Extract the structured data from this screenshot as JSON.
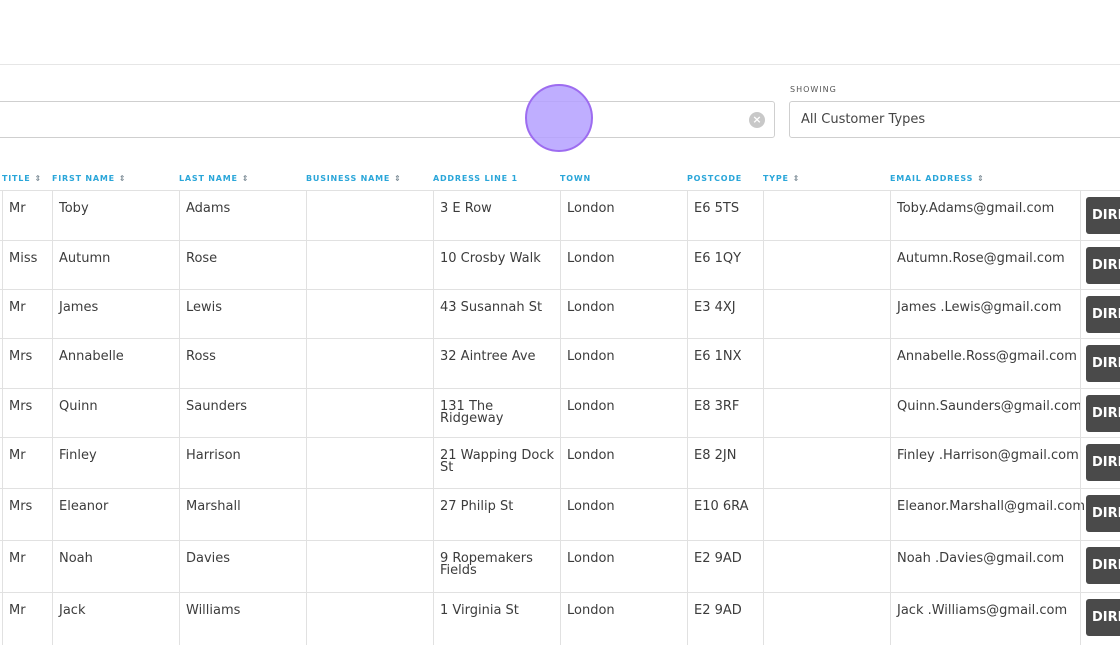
{
  "search": {
    "value": "",
    "clear_icon": "clear-circle-icon"
  },
  "filter": {
    "label": "SHOWING",
    "selected": "All Customer Types"
  },
  "table": {
    "columns": [
      {
        "label": "TITLE",
        "sortable": true
      },
      {
        "label": "FIRST NAME",
        "sortable": true
      },
      {
        "label": "LAST NAME",
        "sortable": true
      },
      {
        "label": "BUSINESS NAME",
        "sortable": true
      },
      {
        "label": "ADDRESS LINE 1",
        "sortable": false
      },
      {
        "label": "TOWN",
        "sortable": false
      },
      {
        "label": "POSTCODE",
        "sortable": false
      },
      {
        "label": "TYPE",
        "sortable": true
      },
      {
        "label": "EMAIL ADDRESS",
        "sortable": true
      }
    ],
    "sort_icon": "⌃⌄",
    "action_label": "DIRE",
    "rows": [
      {
        "title": "Mr",
        "first": "Toby",
        "last": "Adams",
        "business": "",
        "address": "3 E Row",
        "town": "London",
        "postcode": "E6 5TS",
        "type": "",
        "email": "Toby.Adams@gmail.com"
      },
      {
        "title": "Miss",
        "first": "Autumn",
        "last": "Rose",
        "business": "",
        "address": "10 Crosby Walk",
        "town": "London",
        "postcode": "E6 1QY",
        "type": "",
        "email": "Autumn.Rose@gmail.com"
      },
      {
        "title": "Mr",
        "first": "James",
        "last": "Lewis",
        "business": "",
        "address": "43 Susannah St",
        "town": "London",
        "postcode": "E3 4XJ",
        "type": "",
        "email": "James .Lewis@gmail.com"
      },
      {
        "title": "Mrs",
        "first": "Annabelle",
        "last": "Ross",
        "business": "",
        "address": "32 Aintree Ave",
        "town": "London",
        "postcode": "E6 1NX",
        "type": "",
        "email": "Annabelle.Ross@gmail.com"
      },
      {
        "title": "Mrs",
        "first": "Quinn",
        "last": "Saunders",
        "business": "",
        "address": "131 The Ridgeway",
        "town": "London",
        "postcode": "E8 3RF",
        "type": "",
        "email": "Quinn.Saunders@gmail.com"
      },
      {
        "title": "Mr",
        "first": "Finley",
        "last": "Harrison",
        "business": "",
        "address": "21 Wapping Dock St",
        "town": "London",
        "postcode": "E8 2JN",
        "type": "",
        "email": "Finley .Harrison@gmail.com"
      },
      {
        "title": "Mrs",
        "first": "Eleanor",
        "last": "Marshall",
        "business": "",
        "address": "27 Philip St",
        "town": "London",
        "postcode": "E10 6RA",
        "type": "",
        "email": "Eleanor.Marshall@gmail.com"
      },
      {
        "title": "Mr",
        "first": "Noah",
        "last": "Davies",
        "business": "",
        "address": "9 Ropemakers Fields",
        "town": "London",
        "postcode": "E2 9AD",
        "type": "",
        "email": "Noah .Davies@gmail.com"
      },
      {
        "title": "Mr",
        "first": "Jack",
        "last": "Williams",
        "business": "",
        "address": "1 Virginia St",
        "town": "London",
        "postcode": "E2 9AD",
        "type": "",
        "email": "Jack .Williams@gmail.com"
      }
    ]
  }
}
